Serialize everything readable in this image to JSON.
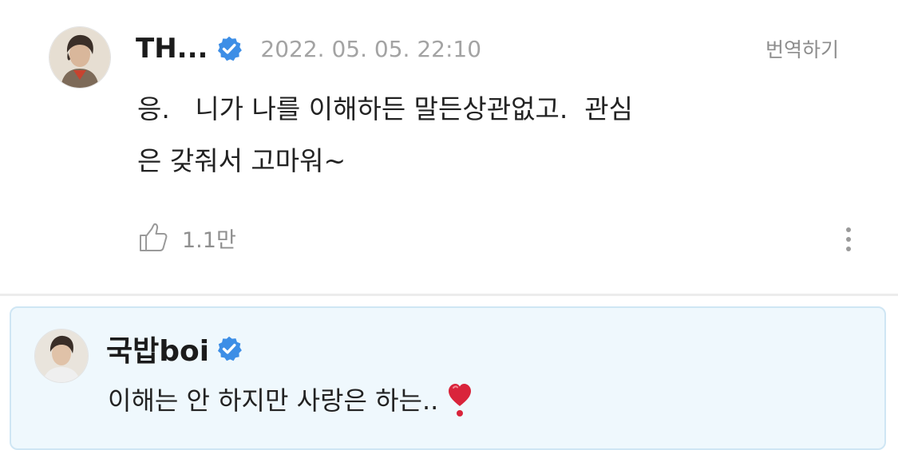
{
  "comment": {
    "author": "TH...",
    "verified": true,
    "timestamp": "2022. 05. 05. 22:10",
    "translate_label": "번역하기",
    "body_lines": [
      "응.   니가 나를 이해하든 말든상관없고.  관심",
      "은 갖줘서 고마워~"
    ],
    "like_count": "1.1만",
    "avatar_icon": "user-avatar",
    "like_icon": "thumbs-up-icon",
    "more_icon": "more-vertical-icon"
  },
  "reply": {
    "author": "국밥boi",
    "verified": true,
    "text": "이해는 안 하지만 사랑은 하는..",
    "emoji": "heart-exclamation-icon",
    "avatar_icon": "user-avatar"
  },
  "colors": {
    "verified_badge": "#3d8ee6",
    "reply_background": "#eff8fd",
    "reply_border": "#cfe6f4",
    "muted_text": "#a3a3a3",
    "heart": "#d9243b"
  }
}
